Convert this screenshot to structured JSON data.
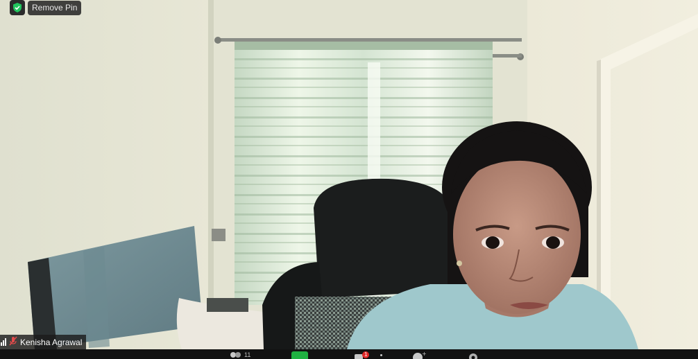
{
  "pin_control": {
    "label": "Remove Pin",
    "icon": "shield-check-icon",
    "accent": "#22c55e"
  },
  "participant": {
    "name": "Kenisha Agrawal",
    "audio_icon": "signal-bars-icon",
    "mic_icon": "mic-muted-icon"
  },
  "toolbar": {
    "participants_count": "11",
    "chat_badge": "1",
    "share_color": "#1fb141"
  }
}
